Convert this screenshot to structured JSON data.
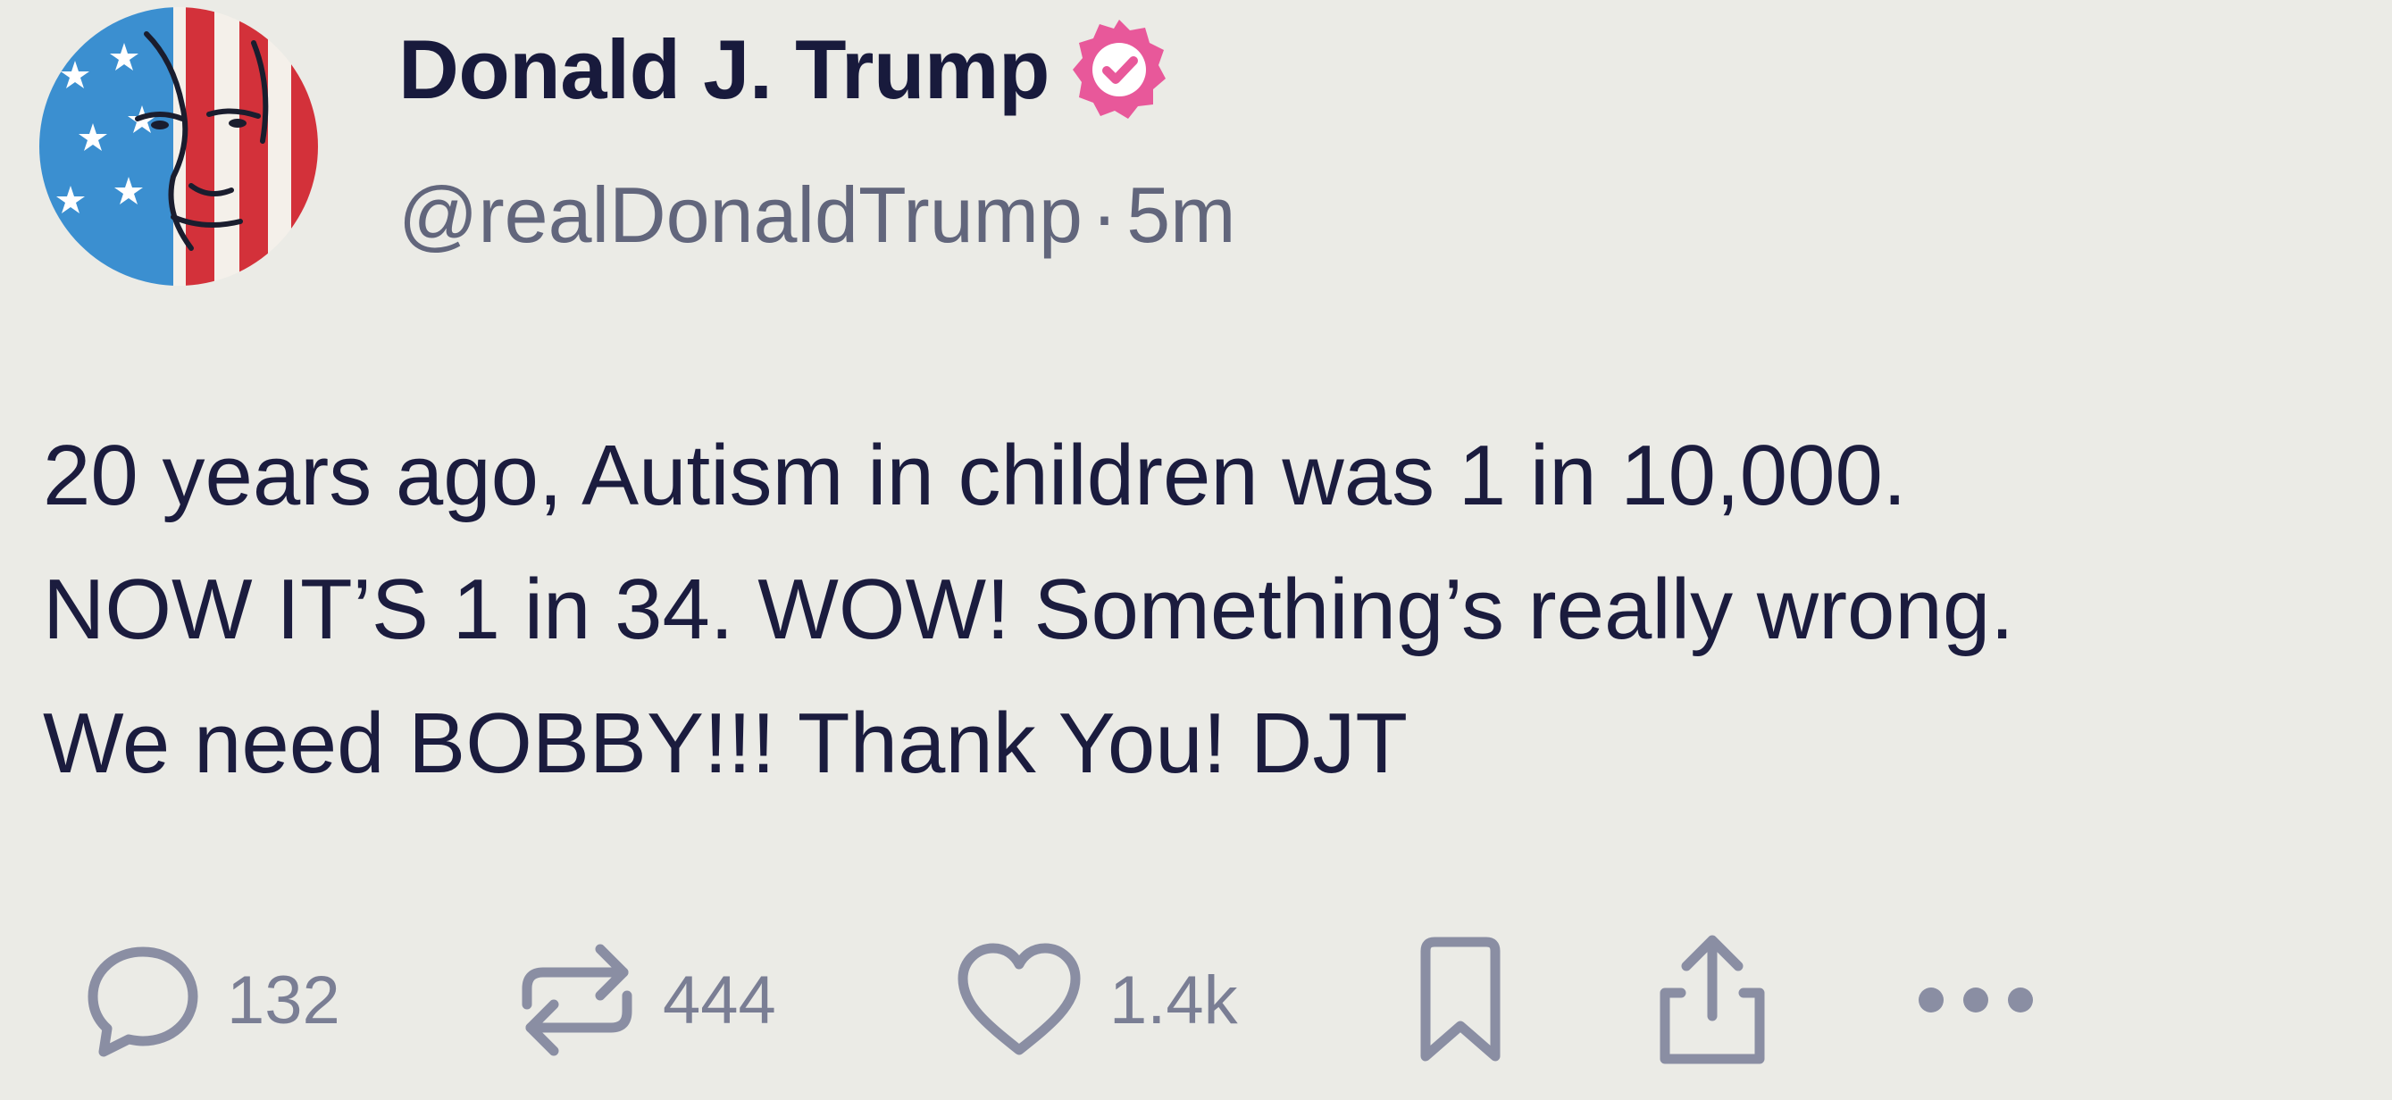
{
  "post": {
    "author": {
      "display_name": "Donald J. Trump",
      "handle": "@realDonaldTrump",
      "verified_badge_color": "#e8589a",
      "verified_icon": "verified-badge-icon"
    },
    "separator": "·",
    "age": "5m",
    "body_lines": [
      "20 years ago, Autism in children was 1 in 10,000.",
      "NOW IT’S 1 in 34. WOW! Something’s really wrong.",
      "We need BOBBY!!!  Thank You! DJT"
    ]
  },
  "actions": {
    "replies": {
      "icon": "reply-icon",
      "count": "132"
    },
    "reposts": {
      "icon": "repost-icon",
      "count": "444"
    },
    "likes": {
      "icon": "heart-icon",
      "count": "1.4k"
    },
    "bookmark": {
      "icon": "bookmark-icon"
    },
    "share": {
      "icon": "share-icon"
    },
    "more": {
      "icon": "more-icon"
    }
  },
  "colors": {
    "background": "#ebebe6",
    "text": "#1b1c3e",
    "muted_text": "#62667c",
    "action_icon": "#8a8ea3",
    "verified": "#e8589a"
  }
}
